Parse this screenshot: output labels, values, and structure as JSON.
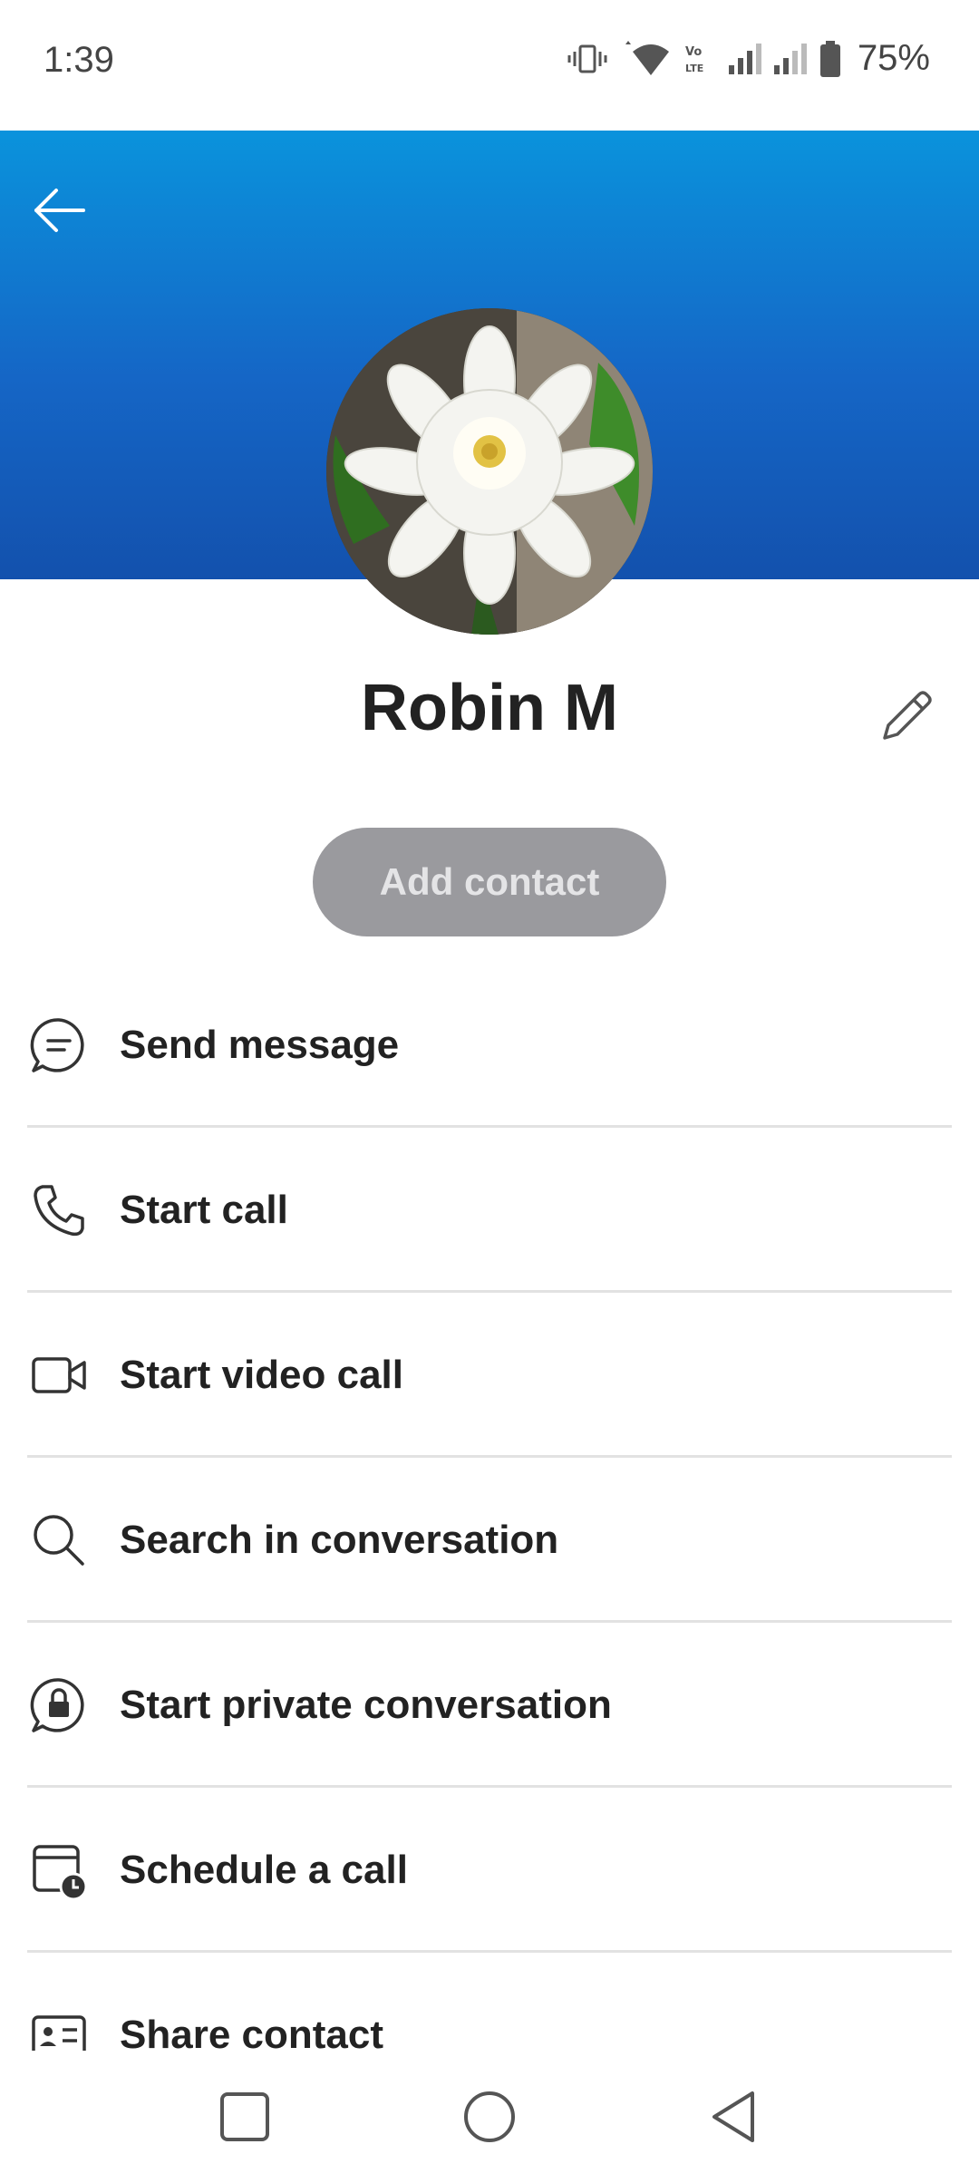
{
  "status_bar": {
    "time": "1:39",
    "battery_percent": "75%",
    "icons": [
      "vibrate-icon",
      "wifi-icon",
      "volte-icon",
      "signal-icon",
      "signal-icon",
      "battery-icon"
    ]
  },
  "header": {
    "back_icon": "arrow-left-icon",
    "gradient": [
      "#0a93dc",
      "#1351ad"
    ]
  },
  "profile": {
    "name": "Robin M",
    "avatar": "white flower photo",
    "edit_icon": "pencil-icon",
    "add_contact_label": "Add contact"
  },
  "actions": [
    {
      "label": "Send message",
      "icon": "chat-bubble-icon"
    },
    {
      "label": "Start call",
      "icon": "phone-icon"
    },
    {
      "label": "Start video call",
      "icon": "video-camera-icon"
    },
    {
      "label": "Search in conversation",
      "icon": "search-icon"
    },
    {
      "label": "Start private conversation",
      "icon": "lock-chat-icon"
    },
    {
      "label": "Schedule a call",
      "icon": "calendar-clock-icon"
    },
    {
      "label": "Share contact",
      "icon": "contact-card-icon"
    }
  ],
  "nav_bar": {
    "buttons": [
      "recents-square-icon",
      "home-circle-icon",
      "back-triangle-icon"
    ]
  },
  "colors": {
    "accent": "#1566c6",
    "button_disabled": "#9a9a9e",
    "text": "#222222"
  }
}
